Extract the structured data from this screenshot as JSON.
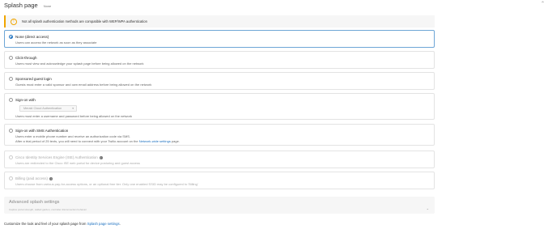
{
  "header": {
    "title": "Splash page",
    "subtitle": "None",
    "collapse_icon": "chevron-up-icon"
  },
  "alert": {
    "icon": "warning-icon",
    "text": "Not all splash authentication methods are compatible with WEP/WPA authentication",
    "accent_color": "#f0a500"
  },
  "options": [
    {
      "label": "None (direct access)",
      "desc1": "Users can access the network as soon as they associate",
      "selected": true
    },
    {
      "label": "Click-through",
      "desc1": "Users must view and acknowledge your splash page before being allowed on the network"
    },
    {
      "label": "Sponsored guest login",
      "desc1": "Guests must enter a valid sponsor and own email address before being allowed on the network"
    },
    {
      "label": "Sign-on with",
      "select_value": "Meraki Cloud Authentication",
      "desc1": "Users must enter a username and password before being allowed on the network"
    },
    {
      "label": "Sign-on with SMS Authentication",
      "desc1": "Users enter a mobile phone number and receive an authorization code via SMS.",
      "desc2_prefix": "After a trial period of 25 texts, you will need to connect with your Twilio account on the ",
      "desc2_link": "Network-wide settings",
      "desc2_suffix": " page."
    },
    {
      "label": "Cisco Identity Services Engine (ISE) Authentication",
      "desc1": "Users are redirected to the Cisco ISE web portal for device posturing and guest access",
      "disabled": true
    },
    {
      "label": "Billing (paid access)",
      "desc1": "Users choose from various pay-for-access options, or an optional free tier. Only one enabled SSID may be configured to 'Billing'",
      "disabled": true
    }
  ],
  "advanced": {
    "title": "Advanced splash settings",
    "subtitle": "Captive portal strength, walled garden, controller disconnection behavior",
    "chevron_icon": "chevron-down-icon"
  },
  "footer": {
    "text": "Customize the look and feel of your splash page from ",
    "link": "Splash page settings",
    "suffix": "."
  },
  "colors": {
    "accent": "#1a6fbf",
    "selected_border": "#6ea6d6"
  }
}
